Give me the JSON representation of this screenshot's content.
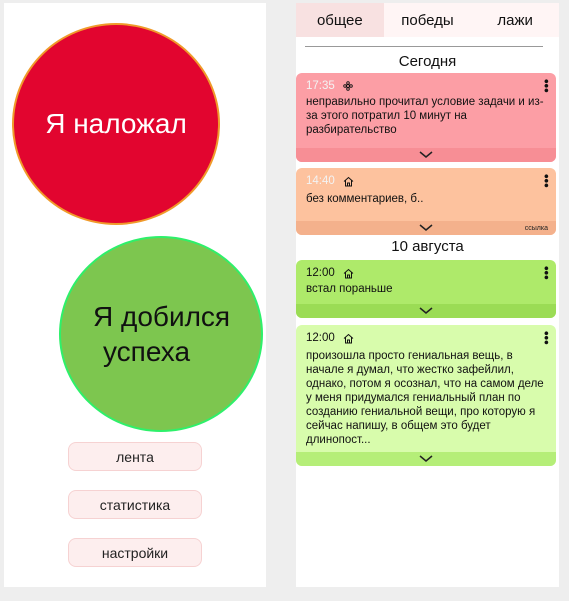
{
  "left": {
    "fail_button": "Я наложал",
    "success_button": {
      "line1": "Я добился",
      "line2": "успеха"
    },
    "menu": {
      "feed": "лента",
      "stats": "статистика",
      "settings": "настройки"
    }
  },
  "right": {
    "tabs": [
      "общее",
      "победы",
      "лажи"
    ],
    "groups": [
      {
        "label": "Сегодня"
      },
      {
        "label": "10 августа"
      }
    ],
    "cards": [
      {
        "time": "17:35",
        "icon": "flower-icon",
        "text": "неправильно прочитал условие задачи и из-за этого потратил 10 минут на разбирательство",
        "color": "#fc9ea5"
      },
      {
        "time": "14:40",
        "icon": "home-icon",
        "text": "без комментариев, б..",
        "link": "ссылка",
        "color": "#fdc29e"
      },
      {
        "time": "12:00",
        "icon": "home-icon",
        "text": "встал пораньше",
        "color": "#aeea6a"
      },
      {
        "time": "12:00",
        "icon": "home-icon",
        "text": "произошла просто гениальная вещь, в начале я думал, что жестко зафейлил, однако, потом я осознал, что на самом деле у меня придумался гениальный план по созданию гениальной вещи, про которую я сейчас напишу, в общем это будет длинопост...",
        "color": "#d8fcac"
      }
    ]
  }
}
